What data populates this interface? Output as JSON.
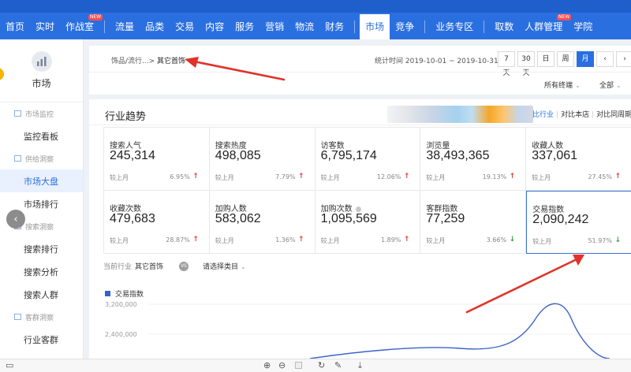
{
  "nav": {
    "items": [
      {
        "label": "首页"
      },
      {
        "label": "实时"
      },
      {
        "label": "作战室",
        "badge": "NEW"
      },
      {
        "label": "流量"
      },
      {
        "label": "品类"
      },
      {
        "label": "交易"
      },
      {
        "label": "内容"
      },
      {
        "label": "服务"
      },
      {
        "label": "营销"
      },
      {
        "label": "物流"
      },
      {
        "label": "财务"
      },
      {
        "label": "市场",
        "active": true
      },
      {
        "label": "竞争"
      },
      {
        "label": "业务专区"
      },
      {
        "label": "取数"
      },
      {
        "label": "人群管理",
        "badge": "NEW"
      },
      {
        "label": "学院"
      }
    ]
  },
  "sidebar": {
    "title": "市场",
    "logo_icon": "chart-icon",
    "groups": [
      {
        "label": "市场监控",
        "items": [
          {
            "label": "监控看板"
          }
        ]
      },
      {
        "label": "供给洞察",
        "items": [
          {
            "label": "市场大盘",
            "active": true
          },
          {
            "label": "市场排行"
          }
        ]
      },
      {
        "label": "搜索洞察",
        "items": [
          {
            "label": "搜索排行"
          },
          {
            "label": "搜索分析"
          },
          {
            "label": "搜索人群"
          }
        ]
      },
      {
        "label": "客群洞察",
        "items": [
          {
            "label": "行业客群"
          }
        ]
      }
    ]
  },
  "filter": {
    "breadcrumb_prefix": "饰品/流行...>",
    "breadcrumb_current": "其它首饰",
    "stat_time": "统计时间 2019-10-01 ~ 2019-10-31",
    "periods": [
      {
        "label": "7天"
      },
      {
        "label": "30天"
      },
      {
        "label": "日"
      },
      {
        "label": "周"
      },
      {
        "label": "月",
        "active": true
      }
    ],
    "prev_label": "‹",
    "next_label": "›",
    "terminal": "所有终端",
    "scope": "全部"
  },
  "panel": {
    "title": "行业趋势",
    "compare_industry": "比行业",
    "compare_shop": "对比本店",
    "compare_peer": "对比同周期"
  },
  "metrics": [
    {
      "label": "搜索人气",
      "value": "245,314",
      "cmp": "较上月",
      "pct": "6.95%",
      "dir": "up"
    },
    {
      "label": "搜索热度",
      "value": "498,085",
      "cmp": "较上月",
      "pct": "7.79%",
      "dir": "up"
    },
    {
      "label": "访客数",
      "value": "6,795,174",
      "cmp": "较上月",
      "pct": "12.06%",
      "dir": "up"
    },
    {
      "label": "浏览量",
      "value": "38,493,365",
      "cmp": "较上月",
      "pct": "19.13%",
      "dir": "up"
    },
    {
      "label": "收藏人数",
      "value": "337,061",
      "cmp": "较上月",
      "pct": "27.45%",
      "dir": "up"
    },
    {
      "label": "收藏次数",
      "value": "479,683",
      "cmp": "较上月",
      "pct": "28.87%",
      "dir": "up"
    },
    {
      "label": "加购人数",
      "value": "583,062",
      "cmp": "较上月",
      "pct": "1.36%",
      "dir": "up"
    },
    {
      "label": "加购次数",
      "value": "1,095,569",
      "cmp": "较上月",
      "pct": "1.89%",
      "dir": "up",
      "info": true
    },
    {
      "label": "客群指数",
      "value": "77,259",
      "cmp": "较上月",
      "pct": "3.66%",
      "dir": "down"
    },
    {
      "label": "交易指数",
      "value": "2,090,242",
      "cmp": "较上月",
      "pct": "51.97%",
      "dir": "down",
      "selected": true
    }
  ],
  "industry": {
    "label": "当前行业",
    "current": "其它首饰",
    "vs": "VS",
    "category_select": "请选择类目"
  },
  "chart": {
    "legend": "交易指数",
    "series_color": "#3a62c9",
    "yticks": [
      "3,200,000",
      "2,400,000"
    ]
  },
  "colors": {
    "nav_bg": "#2a6fe0",
    "accent": "#2a6fe0",
    "up": "#e43d3d",
    "down": "#2e9e45",
    "annotation": "#e0322a"
  },
  "bottom_toolbar": {
    "icons": [
      "screen-icon",
      "zoom-in-icon",
      "zoom-out-icon",
      "fit-icon",
      "rotate-icon",
      "edit-icon",
      "download-icon"
    ]
  }
}
